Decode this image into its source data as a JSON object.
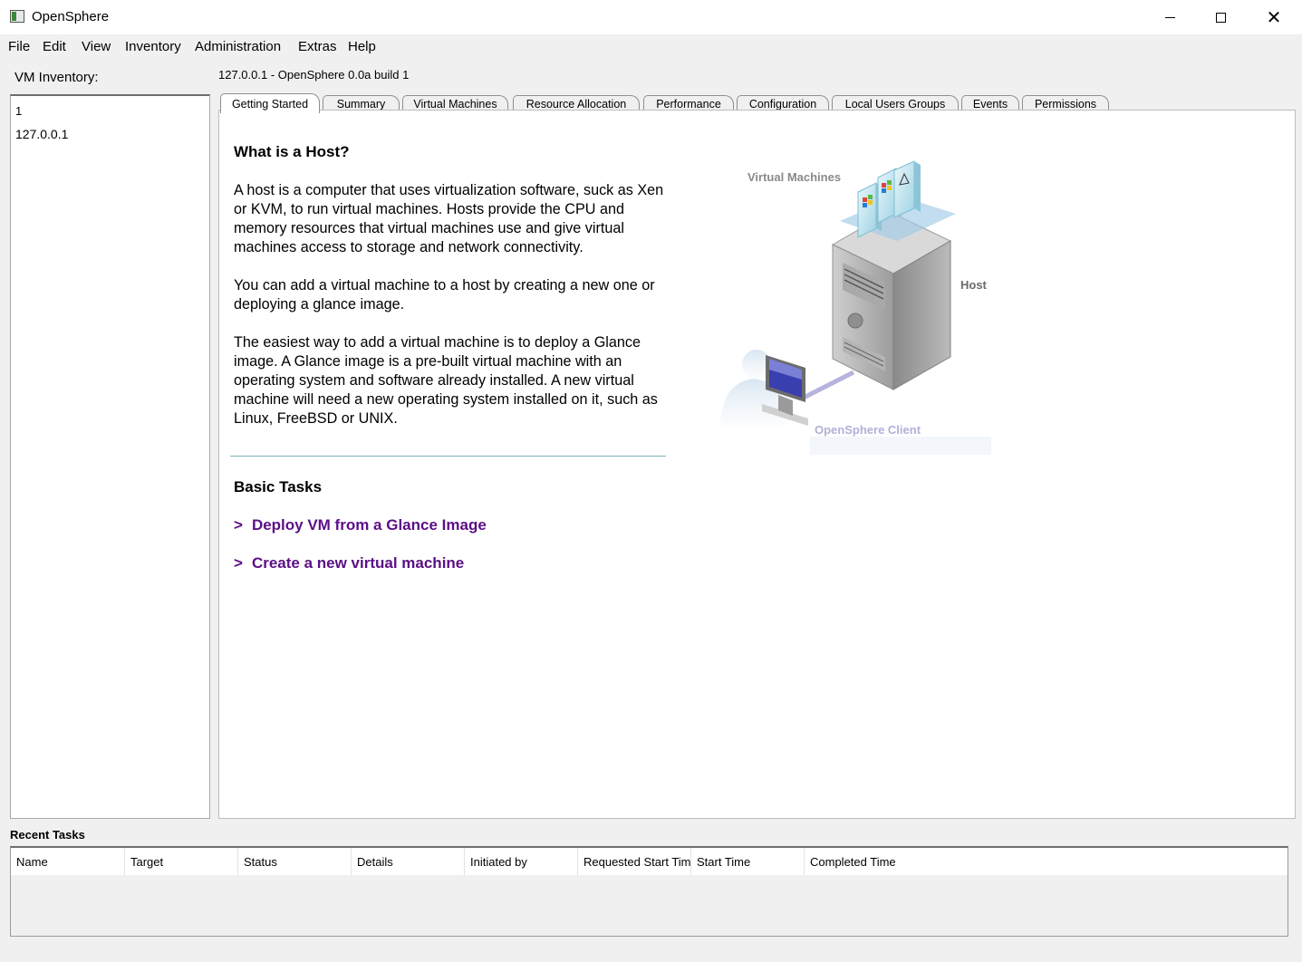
{
  "window": {
    "title": "OpenSphere"
  },
  "menu": [
    "File",
    "Edit",
    "View",
    "Inventory",
    "Administration",
    "Extras",
    "Help"
  ],
  "inventory": {
    "label": "VM Inventory:",
    "items": [
      "1",
      "127.0.0.1"
    ]
  },
  "host_header": "127.0.0.1 - OpenSphere 0.0a build 1",
  "tabs": [
    "Getting Started",
    "Summary",
    "Virtual Machines",
    "Resource Allocation",
    "Performance",
    "Configuration",
    "Local Users  Groups",
    "Events",
    "Permissions"
  ],
  "active_tab": "Getting Started",
  "getting_started": {
    "heading": "What is a Host?",
    "paragraphs": [
      "A host is a computer that uses virtualization software, suck as Xen or KVM, to run virtual machines. Hosts provide the CPU and memory resources that virtual machines use and give virtual machines access to storage and network connectivity.",
      "You can add a virtual machine to a host by creating a new one or deploying a glance image.",
      "The easiest way to add a virtual machine is to deploy a Glance image. A Glance image is a pre-built virtual machine with an operating system and software already installed. A new virtual machine will need a new operating system installed on it, such as Linux, FreeBSD or UNIX."
    ],
    "diagram": {
      "vm_label": "Virtual Machines",
      "host_label": "Host",
      "client_label": "OpenSphere Client"
    },
    "tasks_heading": "Basic Tasks",
    "tasks": [
      {
        "arrow": ">",
        "label": "Deploy VM from a Glance Image"
      },
      {
        "arrow": ">",
        "label": "Create a new virtual machine"
      }
    ],
    "link_color": "#5b0f86"
  },
  "recent_tasks": {
    "label": "Recent Tasks",
    "columns": [
      "Name",
      "Target",
      "Status",
      "Details",
      "Initiated by",
      "Requested Start Tim",
      "Start Time",
      "Completed Time"
    ]
  }
}
